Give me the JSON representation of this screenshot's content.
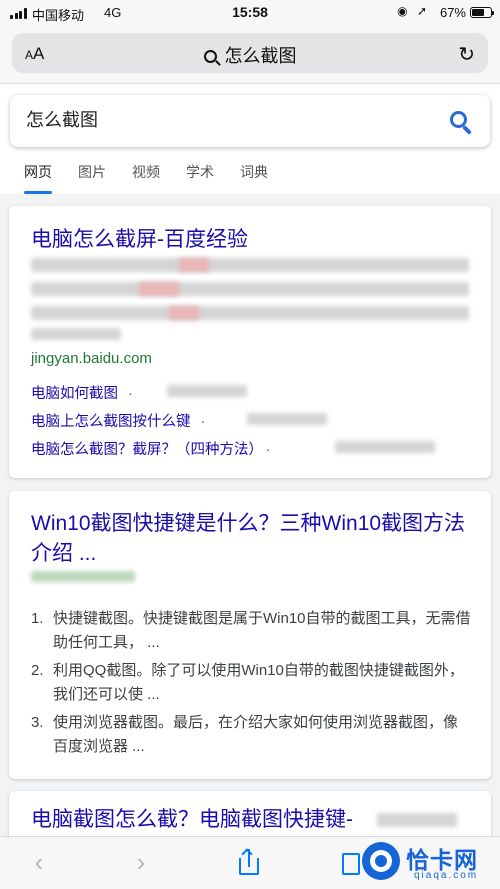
{
  "status_bar": {
    "carrier": "中国移动",
    "network": "4G",
    "time": "15:58",
    "battery": "67%",
    "battery_level": 0.67
  },
  "address_bar": {
    "text_size_label": "AA",
    "query": "怎么截图"
  },
  "search": {
    "value": "怎么截图"
  },
  "tabs": [
    {
      "label": "网页",
      "active": true
    },
    {
      "label": "图片",
      "active": false
    },
    {
      "label": "视频",
      "active": false
    },
    {
      "label": "学术",
      "active": false
    },
    {
      "label": "词典",
      "active": false
    }
  ],
  "results": [
    {
      "title": "电脑怎么截屏-百度经验",
      "url": "jingyan.baidu.com",
      "sublinks": [
        "电脑如何截图",
        "电脑上怎么截图按什么键",
        "电脑怎么截图？截屏？（四种方法）"
      ]
    },
    {
      "title": "Win10截图快捷键是什么？三种Win10截图方法介绍 ...",
      "items": [
        {
          "num": "1.",
          "text": "快捷键截图。快捷键截图是属于Win10自带的截图工具，无需借助任何工具， ..."
        },
        {
          "num": "2.",
          "text": "利用QQ截图。除了可以使用Win10自带的截图快捷键截图外，我们还可以使 ..."
        },
        {
          "num": "3.",
          "text": "使用浏览器截图。最后，在介绍大家如何使用浏览器截图，像百度浏览器 ..."
        }
      ]
    },
    {
      "title": "电脑截图怎么截？电脑截图快捷键-"
    }
  ],
  "watermark": {
    "name": "恰卡网",
    "domain": "qiaqa.com"
  },
  "colors": {
    "link": "#1a0dab",
    "url_green": "#1e7a34",
    "tab_accent": "#1a73e8",
    "ios_blue": "#007aff",
    "watermark_blue": "#1565d8"
  }
}
